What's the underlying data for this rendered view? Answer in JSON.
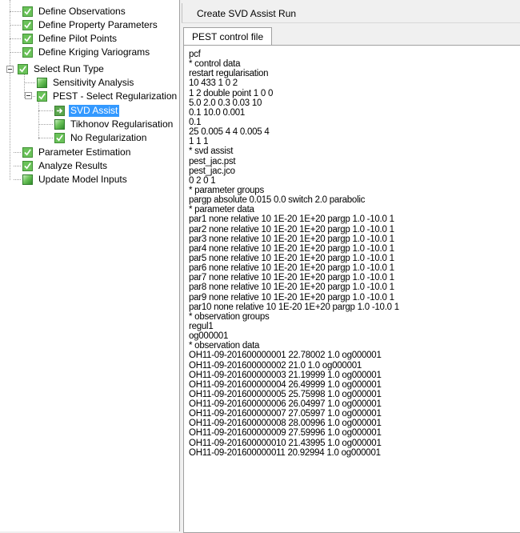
{
  "tree": {
    "items": [
      {
        "label": "Define Observations",
        "icon": "check-icon"
      },
      {
        "label": "Define Property Parameters",
        "icon": "check-icon"
      },
      {
        "label": "Define Pilot Points",
        "icon": "check-icon"
      },
      {
        "label": "Define Kriging Variograms",
        "icon": "check-icon"
      },
      {
        "label": "Select Run Type",
        "icon": "check-icon"
      },
      {
        "label": "Sensitivity Analysis",
        "icon": "progress-icon"
      },
      {
        "label": "PEST - Select Regularization",
        "icon": "check-icon"
      },
      {
        "label": "SVD Assist",
        "icon": "arrow-right-icon"
      },
      {
        "label": "Tikhonov Regularisation",
        "icon": "progress-icon"
      },
      {
        "label": "No Regularization",
        "icon": "check-icon"
      },
      {
        "label": "Parameter Estimation",
        "icon": "check-icon"
      },
      {
        "label": "Analyze Results",
        "icon": "check-icon"
      },
      {
        "label": "Update Model Inputs",
        "icon": "progress-icon"
      }
    ]
  },
  "header": {
    "title": "Create SVD Assist Run"
  },
  "tabs": [
    {
      "label": "PEST control file"
    }
  ],
  "content": {
    "lines": [
      "pcf",
      "* control data",
      "restart regularisation",
      "10 433 1 0 2",
      "1 2 double point 1 0 0",
      "5.0 2.0 0.3 0.03 10",
      "0.1 10.0 0.001",
      "0.1",
      "25 0.005 4 4 0.005 4",
      "1 1 1",
      "* svd assist",
      "pest_jac.pst",
      "pest_jac.jco",
      "0 2 0 1",
      "* parameter groups",
      "pargp absolute 0.015 0.0 switch 2.0 parabolic",
      "* parameter data",
      "par1 none relative 10 1E-20 1E+20 pargp 1.0 -10.0 1",
      "par2 none relative 10 1E-20 1E+20 pargp 1.0 -10.0 1",
      "par3 none relative 10 1E-20 1E+20 pargp 1.0 -10.0 1",
      "par4 none relative 10 1E-20 1E+20 pargp 1.0 -10.0 1",
      "par5 none relative 10 1E-20 1E+20 pargp 1.0 -10.0 1",
      "par6 none relative 10 1E-20 1E+20 pargp 1.0 -10.0 1",
      "par7 none relative 10 1E-20 1E+20 pargp 1.0 -10.0 1",
      "par8 none relative 10 1E-20 1E+20 pargp 1.0 -10.0 1",
      "par9 none relative 10 1E-20 1E+20 pargp 1.0 -10.0 1",
      "par10 none relative 10 1E-20 1E+20 pargp 1.0 -10.0 1",
      "* observation groups",
      "regul1",
      "og000001",
      "* observation data",
      "OH11-09-201600000001 22.78002 1.0 og000001",
      "OH11-09-201600000002 21.0 1.0 og000001",
      "OH11-09-201600000003 21.19999 1.0 og000001",
      "OH11-09-201600000004 26.49999 1.0 og000001",
      "OH11-09-201600000005 25.75998 1.0 og000001",
      "OH11-09-201600000006 26.04997 1.0 og000001",
      "OH11-09-201600000007 27.05997 1.0 og000001",
      "OH11-09-201600000008 28.00996 1.0 og000001",
      "OH11-09-201600000009 27.59996 1.0 og000001",
      "OH11-09-201600000010 21.43995 1.0 og000001",
      "OH11-09-201600000011 20.92994 1.0 og000001"
    ]
  }
}
